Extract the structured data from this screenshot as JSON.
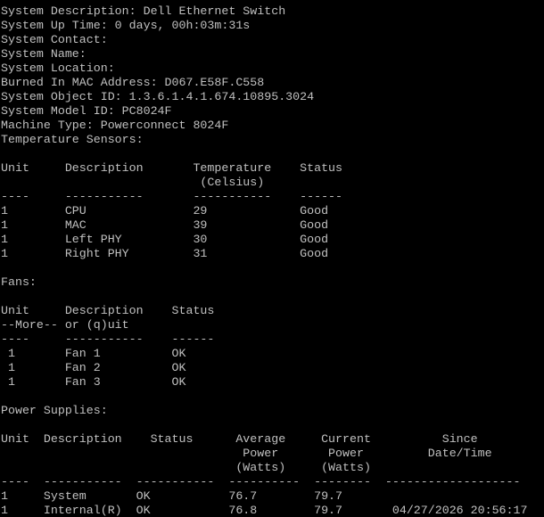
{
  "terminal": {
    "lines": [
      "System Description: Dell Ethernet Switch",
      "System Up Time: 0 days, 00h:03m:31s",
      "System Contact:",
      "System Name:",
      "System Location:",
      "Burned In MAC Address: D067.E58F.C558",
      "System Object ID: 1.3.6.1.4.1.674.10895.3024",
      "System Model ID: PC8024F",
      "Machine Type: Powerconnect 8024F",
      "Temperature Sensors:",
      "",
      "Unit     Description       Temperature    Status",
      "                            (Celsius)",
      "----     -----------       -----------    ------",
      "1        CPU               29             Good",
      "1        MAC               39             Good",
      "1        Left PHY          30             Good",
      "1        Right PHY         31             Good",
      "",
      "Fans:",
      "",
      "Unit     Description    Status",
      "--More-- or (q)uit",
      "----     -----------    ------",
      " 1       Fan 1          OK",
      " 1       Fan 2          OK",
      " 1       Fan 3          OK",
      "",
      "Power Supplies:",
      "",
      "Unit  Description    Status      Average     Current          Since",
      "                                  Power       Power         Date/Time",
      "                                 (Watts)     (Watts)",
      "----  -----------  -----------  ----------  --------  -------------------",
      "1     System       OK           76.7        79.7",
      "1     Internal(R)  OK           76.8        79.7       04/27/2026 20:56:17"
    ]
  },
  "colors": {
    "background": "#000000",
    "foreground": "#c0c0c0"
  }
}
